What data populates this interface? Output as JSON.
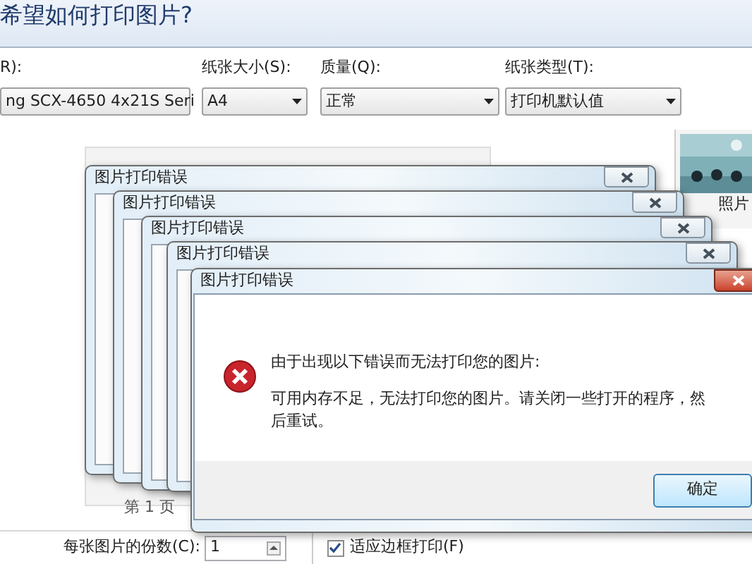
{
  "dialog": {
    "title": "希望如何打印图片?",
    "fields": [
      {
        "label": "R):",
        "value": "ng SCX-4650 4x21S Seri"
      },
      {
        "label": "纸张大小(S):",
        "value": "A4"
      },
      {
        "label": "质量(Q):",
        "value": "正常"
      },
      {
        "label": "纸张类型(T):",
        "value": "打印机默认值"
      }
    ],
    "preview": {
      "page_label": "第 1 页"
    },
    "thumbnail": {
      "kind": "picture",
      "label": "照片"
    },
    "copies": {
      "label": "每张图片的份数(C):",
      "value": "1"
    },
    "fit_frame": {
      "label": "适应边框打印(F)",
      "checked": true
    }
  },
  "error_windows": [
    {
      "title": "图片打印错误",
      "active": false
    },
    {
      "title": "图片打印错误",
      "active": false
    },
    {
      "title": "图片打印错误",
      "active": false
    },
    {
      "title": "图片打印错误",
      "active": false
    },
    {
      "title": "图片打印错误",
      "active": true,
      "message": "由于出现以下错误而无法打印您的图片:",
      "detail": "可用内存不足，无法打印您的图片。请关闭一些打开的程序，然后重试。",
      "button": "确定"
    }
  ]
}
